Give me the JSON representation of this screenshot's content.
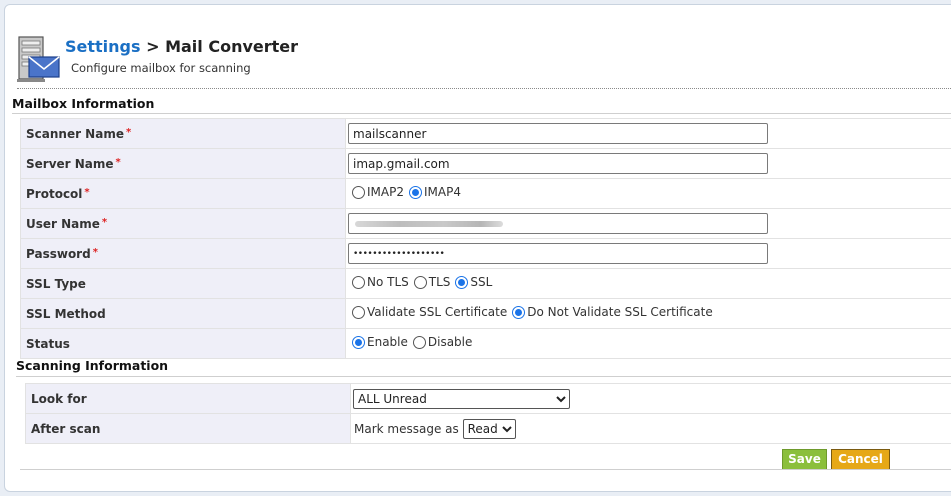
{
  "header": {
    "breadcrumb_link": "Settings",
    "breadcrumb_sep": " > ",
    "page_title": "Mail Converter",
    "subtitle": "Configure mailbox for scanning"
  },
  "mailbox": {
    "section_title": "Mailbox Information",
    "required_mark": "*",
    "scanner_name": {
      "label": "Scanner Name",
      "value": "mailscanner"
    },
    "server_name": {
      "label": "Server Name",
      "value": "imap.gmail.com"
    },
    "protocol": {
      "label": "Protocol",
      "options": [
        "IMAP2",
        "IMAP4"
      ],
      "selected": "IMAP4"
    },
    "user_name": {
      "label": "User Name",
      "value": ""
    },
    "password": {
      "label": "Password",
      "value": "•••••••••••••••••••"
    },
    "ssl_type": {
      "label": "SSL Type",
      "options": [
        "No TLS",
        "TLS",
        "SSL"
      ],
      "selected": "SSL"
    },
    "ssl_method": {
      "label": "SSL Method",
      "options": [
        "Validate SSL Certificate",
        "Do Not Validate SSL Certificate"
      ],
      "selected": "Do Not Validate SSL Certificate"
    },
    "status": {
      "label": "Status",
      "options": [
        "Enable",
        "Disable"
      ],
      "selected": "Enable"
    }
  },
  "scanning": {
    "section_title": "Scanning Information",
    "look_for": {
      "label": "Look for",
      "selected": "ALL Unread"
    },
    "after_scan": {
      "label": "After scan",
      "prefix": "Mark message as",
      "selected": "Read"
    }
  },
  "actions": {
    "save_label": "Save",
    "cancel_label": "Cancel"
  },
  "colors": {
    "link": "#1a6fc4",
    "save": "#8bbf3c",
    "cancel": "#e6a817",
    "label_bg": "#efeff8",
    "required": "#dd2222",
    "radio_on": "#1a73e8"
  },
  "icons": {
    "logo": "mail-server-icon"
  }
}
